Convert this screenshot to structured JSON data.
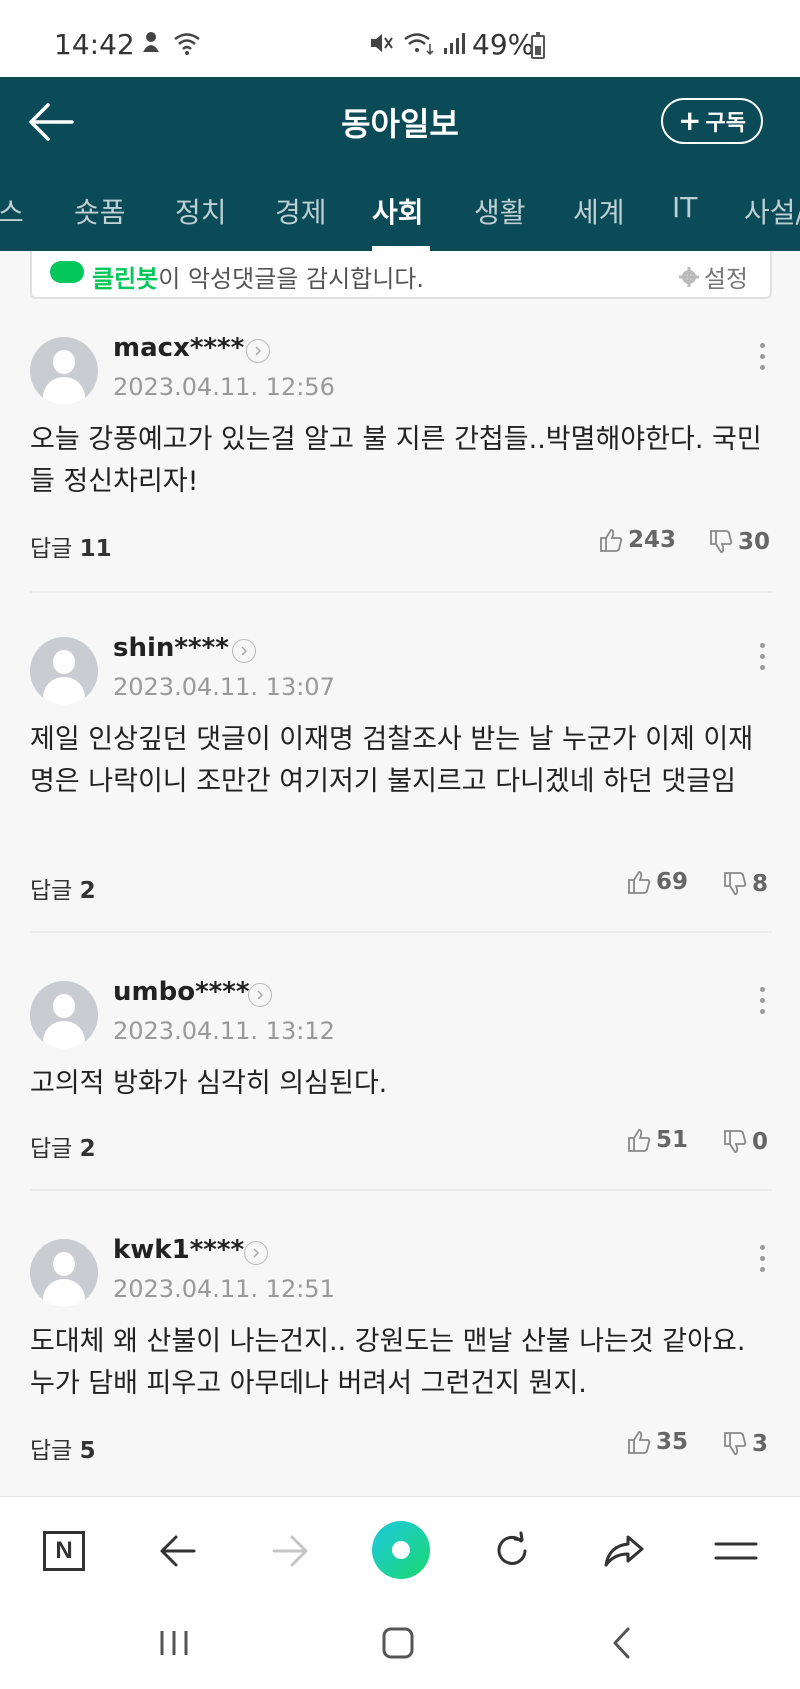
{
  "status_bar": {
    "time": "14:42",
    "battery": "49%"
  },
  "header": {
    "title": "동아일보",
    "subscribe_label": "구독",
    "subscribe_plus": "+"
  },
  "tabs": [
    {
      "label": "스",
      "active": false
    },
    {
      "label": "숏폼",
      "active": false
    },
    {
      "label": "정치",
      "active": false
    },
    {
      "label": "경제",
      "active": false
    },
    {
      "label": "사회",
      "active": true
    },
    {
      "label": "생활",
      "active": false
    },
    {
      "label": "세계",
      "active": false
    },
    {
      "label": "IT",
      "active": false
    },
    {
      "label": "사설/",
      "active": false
    }
  ],
  "cleanbot": {
    "brand": "클린봇",
    "text": "이 악성댓글을 감시합니다.",
    "setting_label": "설정"
  },
  "comments": [
    {
      "user": "macx****",
      "date": "2023.04.11. 12:56",
      "body": "오늘 강풍예고가 있는걸 알고 불 지른 간첩들..박멸해야한다. 국민들 정신차리자!",
      "reply_label": "답글",
      "reply_count": "11",
      "likes": "243",
      "dislikes": "30"
    },
    {
      "user": "shin****",
      "date": "2023.04.11. 13:07",
      "body": "제일 인상깊던 댓글이 이재명 검찰조사 받는 날 누군가 이제 이재명은 나락이니 조만간 여기저기 불지르고 다니겠네 하던 댓글임",
      "reply_label": "답글",
      "reply_count": "2",
      "likes": "69",
      "dislikes": "8"
    },
    {
      "user": "umbo****",
      "date": "2023.04.11. 13:12",
      "body": "고의적 방화가 심각히 의심된다.",
      "reply_label": "답글",
      "reply_count": "2",
      "likes": "51",
      "dislikes": "0"
    },
    {
      "user": "kwk1****",
      "date": "2023.04.11. 12:51",
      "body": "도대체 왜 산불이 나는건지.. 강원도는 맨날 산불 나는것 같아요. 누가 담배 피우고 아무데나 버려서 그런건지 뭔지.",
      "reply_label": "답글",
      "reply_count": "5",
      "likes": "35",
      "dislikes": "3"
    }
  ],
  "toolbar": {
    "home_label": "N"
  },
  "colors": {
    "header_bg": "#0b4a57",
    "cleanbot_green": "#03c75a"
  }
}
